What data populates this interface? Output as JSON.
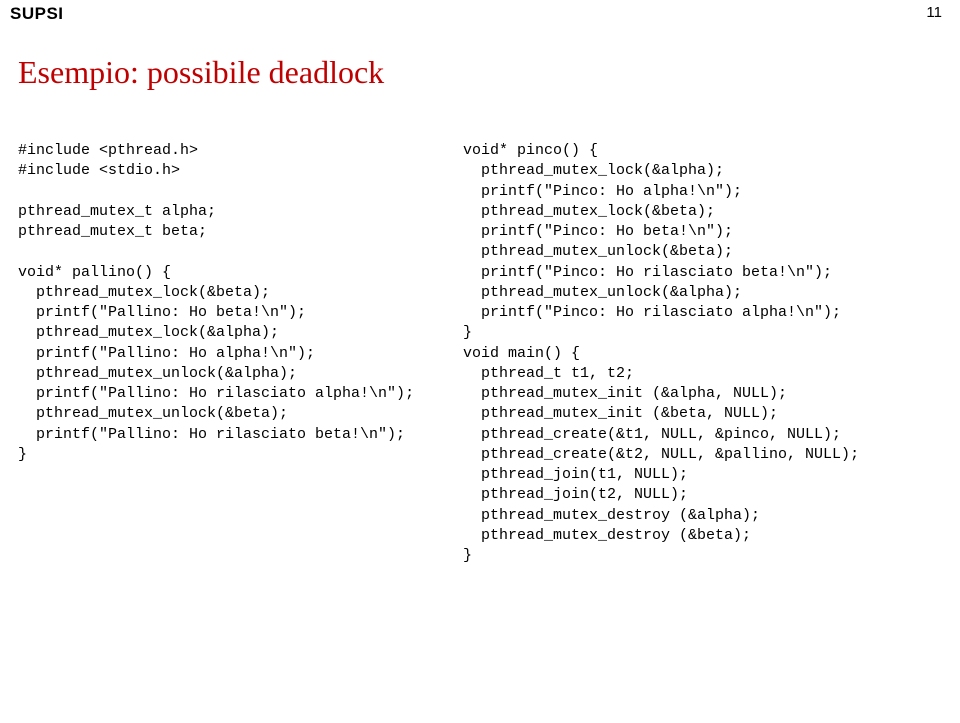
{
  "header": {
    "brand": "SUPSI",
    "page_number": "11"
  },
  "title": "Esempio: possibile deadlock",
  "code_left": "#include <pthread.h>\n#include <stdio.h>\n\npthread_mutex_t alpha;\npthread_mutex_t beta;\n\nvoid* pallino() {\n  pthread_mutex_lock(&beta);\n  printf(\"Pallino: Ho beta!\\n\");\n  pthread_mutex_lock(&alpha);\n  printf(\"Pallino: Ho alpha!\\n\");\n  pthread_mutex_unlock(&alpha);\n  printf(\"Pallino: Ho rilasciato alpha!\\n\");\n  pthread_mutex_unlock(&beta);\n  printf(\"Pallino: Ho rilasciato beta!\\n\");\n}",
  "code_right": "void* pinco() {\n  pthread_mutex_lock(&alpha);\n  printf(\"Pinco: Ho alpha!\\n\");\n  pthread_mutex_lock(&beta);\n  printf(\"Pinco: Ho beta!\\n\");\n  pthread_mutex_unlock(&beta);\n  printf(\"Pinco: Ho rilasciato beta!\\n\");\n  pthread_mutex_unlock(&alpha);\n  printf(\"Pinco: Ho rilasciato alpha!\\n\");\n}\nvoid main() {\n  pthread_t t1, t2;\n  pthread_mutex_init (&alpha, NULL);\n  pthread_mutex_init (&beta, NULL);\n  pthread_create(&t1, NULL, &pinco, NULL);\n  pthread_create(&t2, NULL, &pallino, NULL);\n  pthread_join(t1, NULL);\n  pthread_join(t2, NULL);\n  pthread_mutex_destroy (&alpha);\n  pthread_mutex_destroy (&beta);\n}"
}
